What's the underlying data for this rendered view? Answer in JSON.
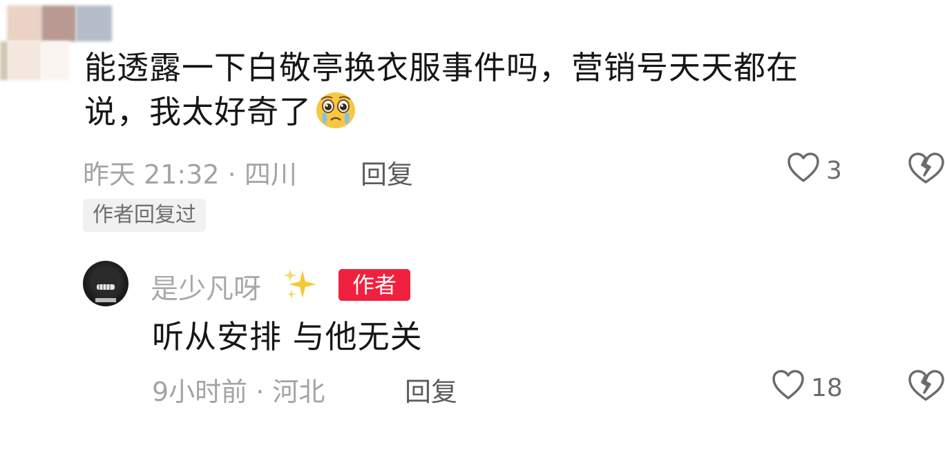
{
  "comment": {
    "text_line1": "能透露一下白敬亭换衣服事件吗，营销号天天都在",
    "text_line2": "说，我太好奇了",
    "emoji": "pleading-face-emoji",
    "time_location": "昨天 21:32 · 四川",
    "reply_label": "回复",
    "like_count": "3",
    "author_replied_tag": "作者回复过"
  },
  "reply": {
    "username": "是少凡呀",
    "username_decoration": "sparkles-icon",
    "badge": "作者",
    "text": "听从安排 与他无关",
    "time_location": "9小时前 · 河北",
    "reply_label": "回复",
    "like_count": "18"
  },
  "colors": {
    "badge_red": "#f0203f",
    "meta_gray": "#a3a3a3",
    "text_dark": "#161616"
  }
}
